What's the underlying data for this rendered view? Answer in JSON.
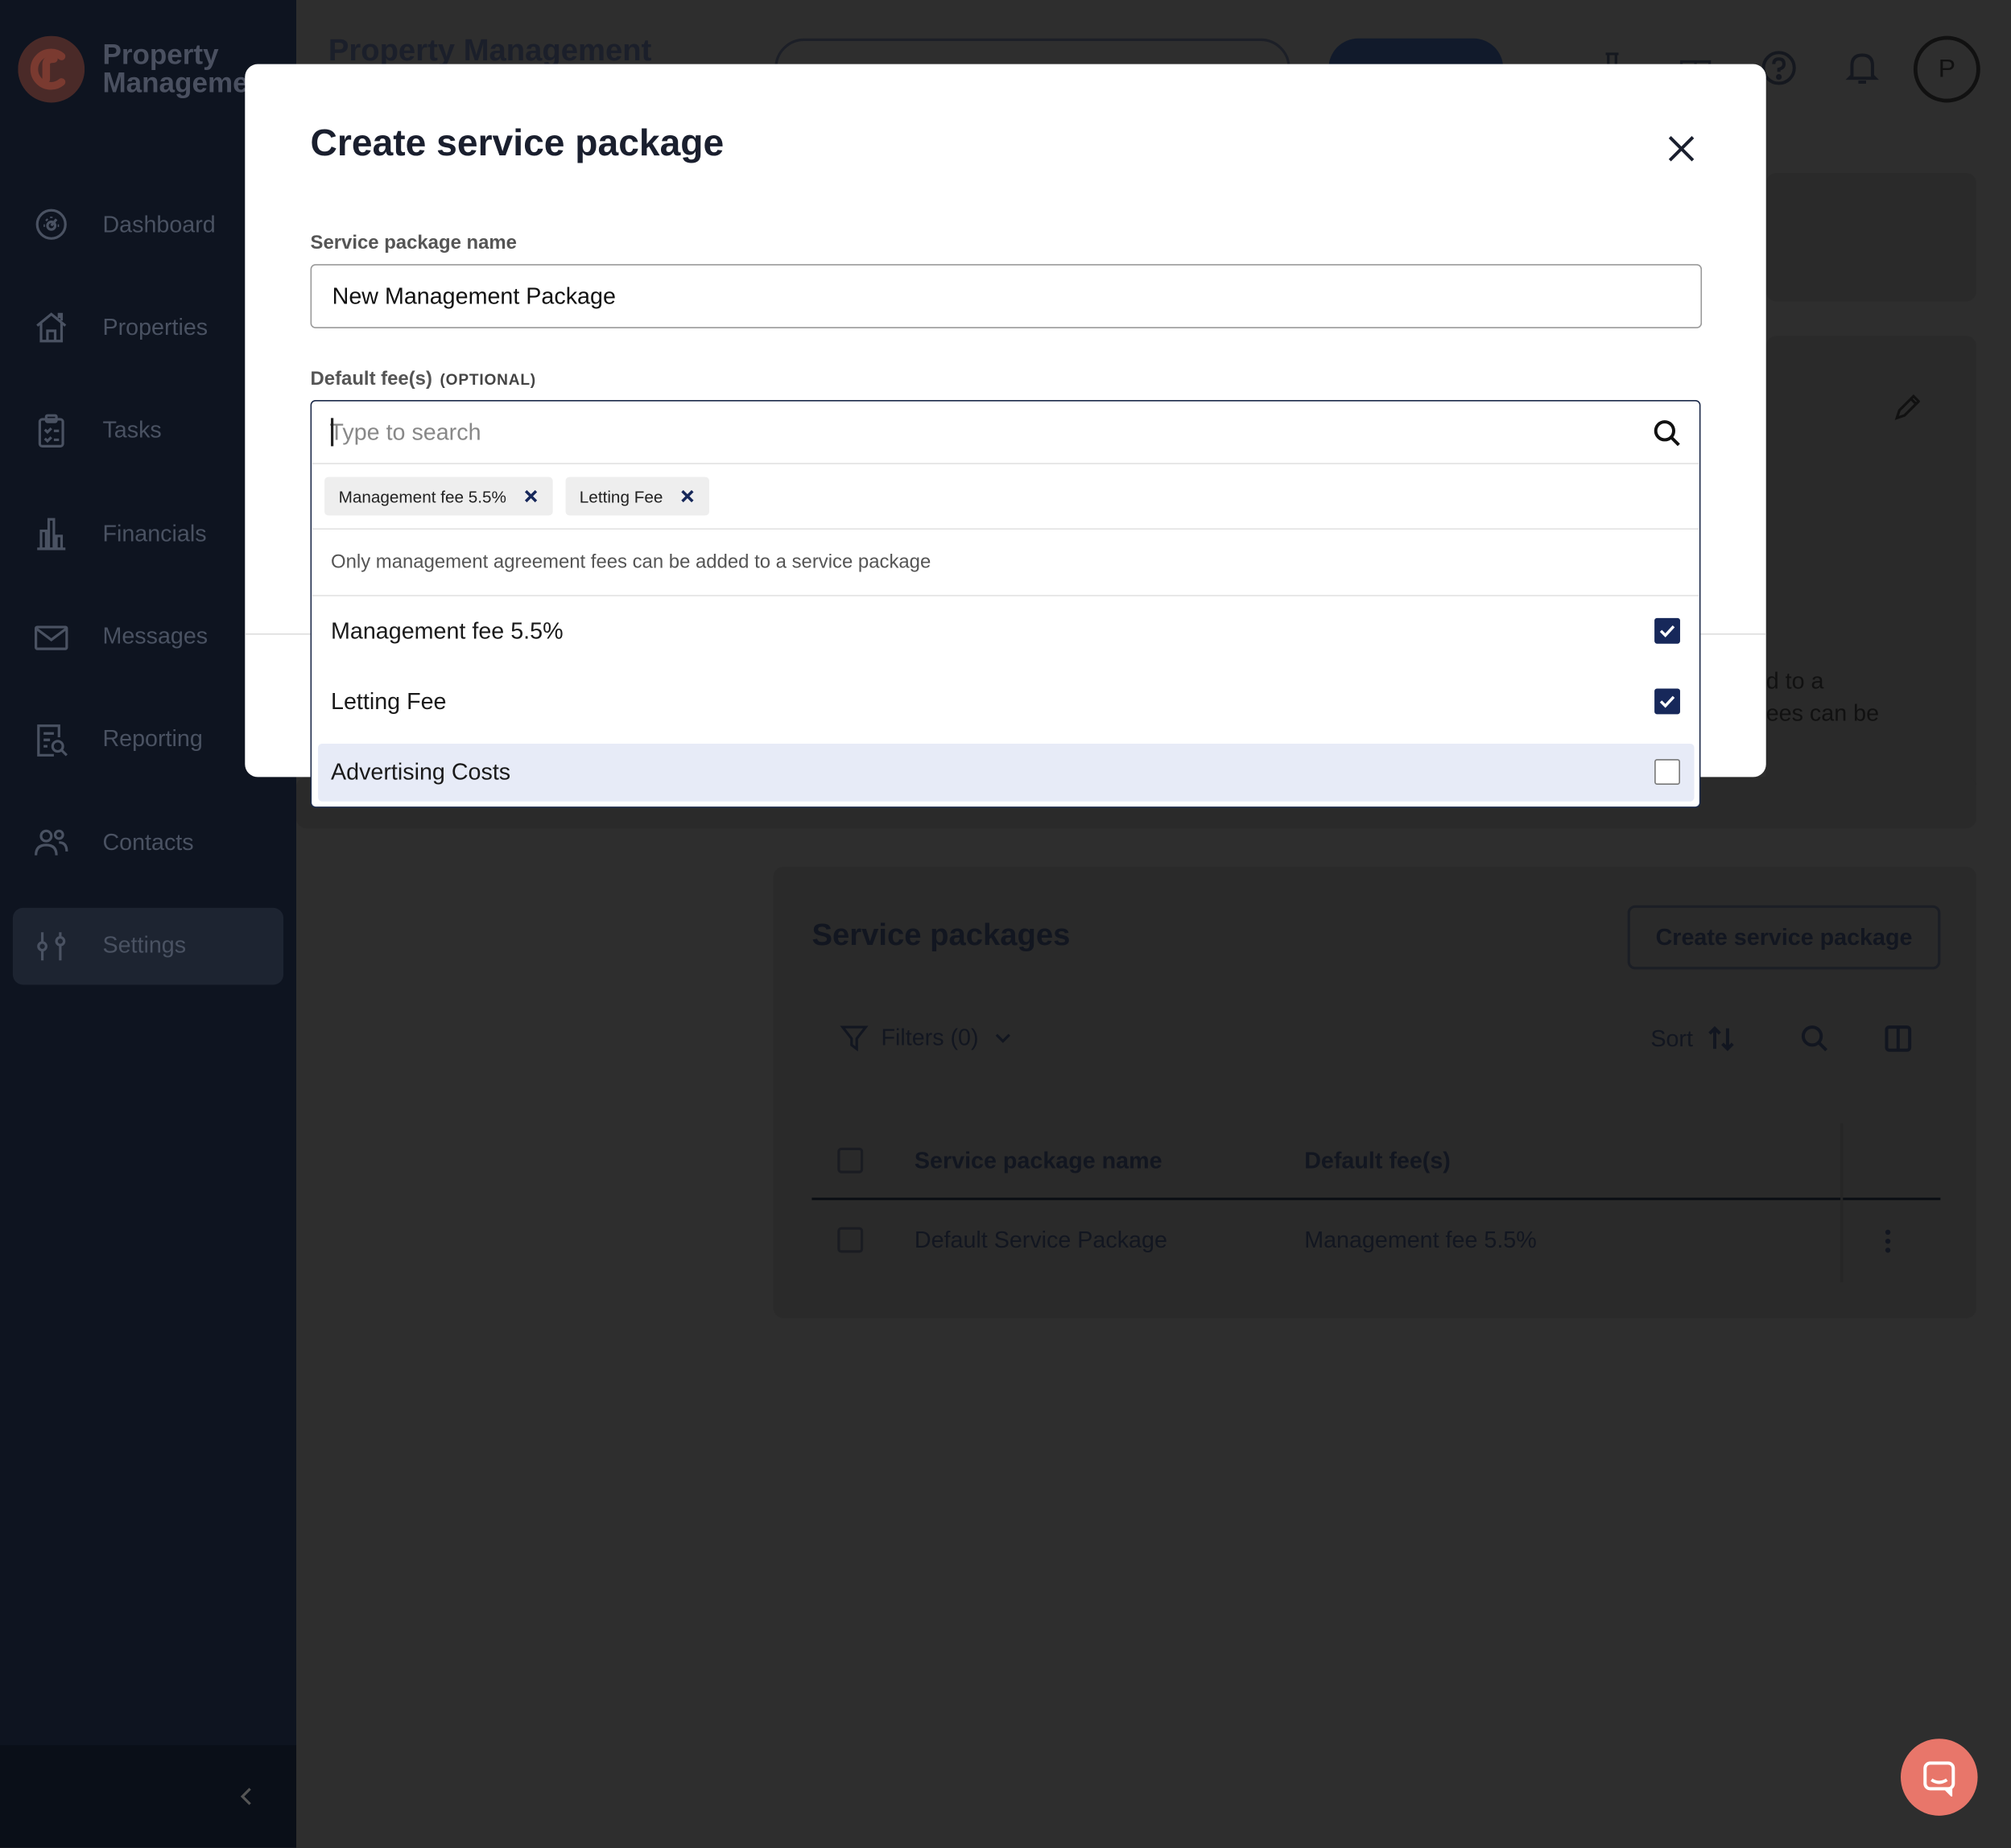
{
  "app": {
    "brand_line1": "Property",
    "brand_line2": "Manageme",
    "page_title": "Property Management",
    "avatar_initial": "P"
  },
  "sidebar": {
    "items": [
      {
        "label": "Dashboard",
        "icon": "dashboard-icon"
      },
      {
        "label": "Properties",
        "icon": "home-icon"
      },
      {
        "label": "Tasks",
        "icon": "clipboard-icon"
      },
      {
        "label": "Financials",
        "icon": "bar-chart-icon"
      },
      {
        "label": "Messages",
        "icon": "mail-icon"
      },
      {
        "label": "Reporting",
        "icon": "report-icon"
      },
      {
        "label": "Contacts",
        "icon": "people-icon"
      },
      {
        "label": "Settings",
        "icon": "sliders-icon",
        "active": true
      }
    ]
  },
  "background": {
    "peek_text_1": "d to a",
    "peek_text_2": "ees can be"
  },
  "service_packages": {
    "title": "Service packages",
    "create_button": "Create service package",
    "filters_label": "Filters (0)",
    "sort_label": "Sort",
    "columns": [
      "Service package name",
      "Default fee(s)"
    ],
    "rows": [
      {
        "name": "Default Service Package",
        "fees": "Management fee 5.5%"
      }
    ]
  },
  "modal": {
    "title": "Create service package",
    "name_label": "Service package name",
    "name_value": "New Management Package",
    "fees_label": "Default fee(s)",
    "fees_optional": "(OPTIONAL)",
    "search_placeholder": "Type to search",
    "selected_chips": [
      "Management fee 5.5%",
      "Letting Fee"
    ],
    "note": "Only management agreement fees can be added to a service package",
    "options": [
      {
        "label": "Management fee 5.5%",
        "checked": true
      },
      {
        "label": "Letting Fee",
        "checked": true
      },
      {
        "label": "Advertising Costs",
        "checked": false
      }
    ]
  },
  "colors": {
    "sidebar_bg": "#0e1420",
    "accent_navy": "#17285a",
    "brand_orange": "#e8766a",
    "highlight": "#e7ebf7"
  }
}
